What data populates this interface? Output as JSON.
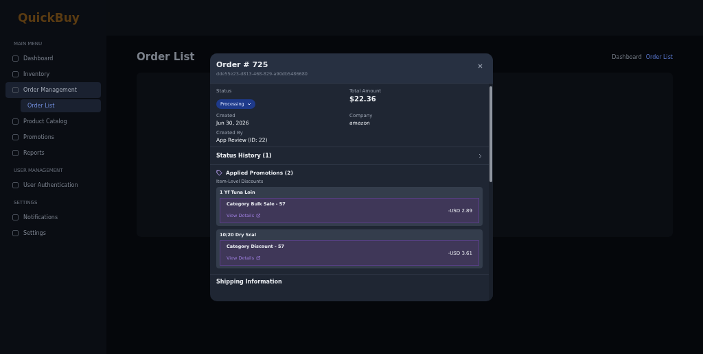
{
  "app": {
    "logo": "QuickBuy"
  },
  "sidebar": {
    "sections": [
      {
        "heading": "MAIN MENU",
        "items": [
          {
            "label": "Dashboard",
            "selected": false
          },
          {
            "label": "Inventory",
            "selected": false
          },
          {
            "label": "Order Management",
            "selected": true,
            "children": [
              {
                "label": "Order List",
                "selected": true
              }
            ]
          },
          {
            "label": "Product Catalog",
            "selected": false
          },
          {
            "label": "Promotions",
            "selected": false
          },
          {
            "label": "Reports",
            "selected": false
          }
        ]
      },
      {
        "heading": "USER MANAGEMENT",
        "items": [
          {
            "label": "User Authentication",
            "selected": false
          }
        ]
      },
      {
        "heading": "SETTINGS",
        "items": [
          {
            "label": "Notifications",
            "selected": false
          },
          {
            "label": "Settings",
            "selected": false
          }
        ]
      }
    ]
  },
  "page": {
    "title": "Order List",
    "breadcrumb": [
      "Dashboard",
      "Order List"
    ]
  },
  "modal": {
    "title": "Order # 725",
    "subtitle": "dde55e23-d813-468-829-a90db5486680",
    "fields": [
      {
        "label": "Status",
        "kind": "status",
        "value": "Processing"
      },
      {
        "label": "Total Amount",
        "kind": "amount",
        "value": "$22.36"
      },
      {
        "label": "Created",
        "kind": "text",
        "value": "Jun 30, 2026"
      },
      {
        "label": "Company",
        "kind": "text",
        "value": "amazon"
      },
      {
        "label": "Created By",
        "kind": "text",
        "value": "App Review (ID: 22)"
      }
    ],
    "status_history": {
      "label": "Status History (1)",
      "expanded": false
    },
    "promotions": {
      "title": "Applied Promotions (2)",
      "subtitle": "Item-Level Discounts",
      "items": [
        {
          "product": "1 Yf Tuna Loin",
          "name": "Category Bulk Sale - 57",
          "link": "View Details",
          "amount": "-USD 2.89"
        },
        {
          "product": "10/20 Dry Scal",
          "name": "Category Discount - 57",
          "link": "View Details",
          "amount": "-USD 3.61"
        }
      ]
    },
    "next_section": "Shipping Information"
  }
}
